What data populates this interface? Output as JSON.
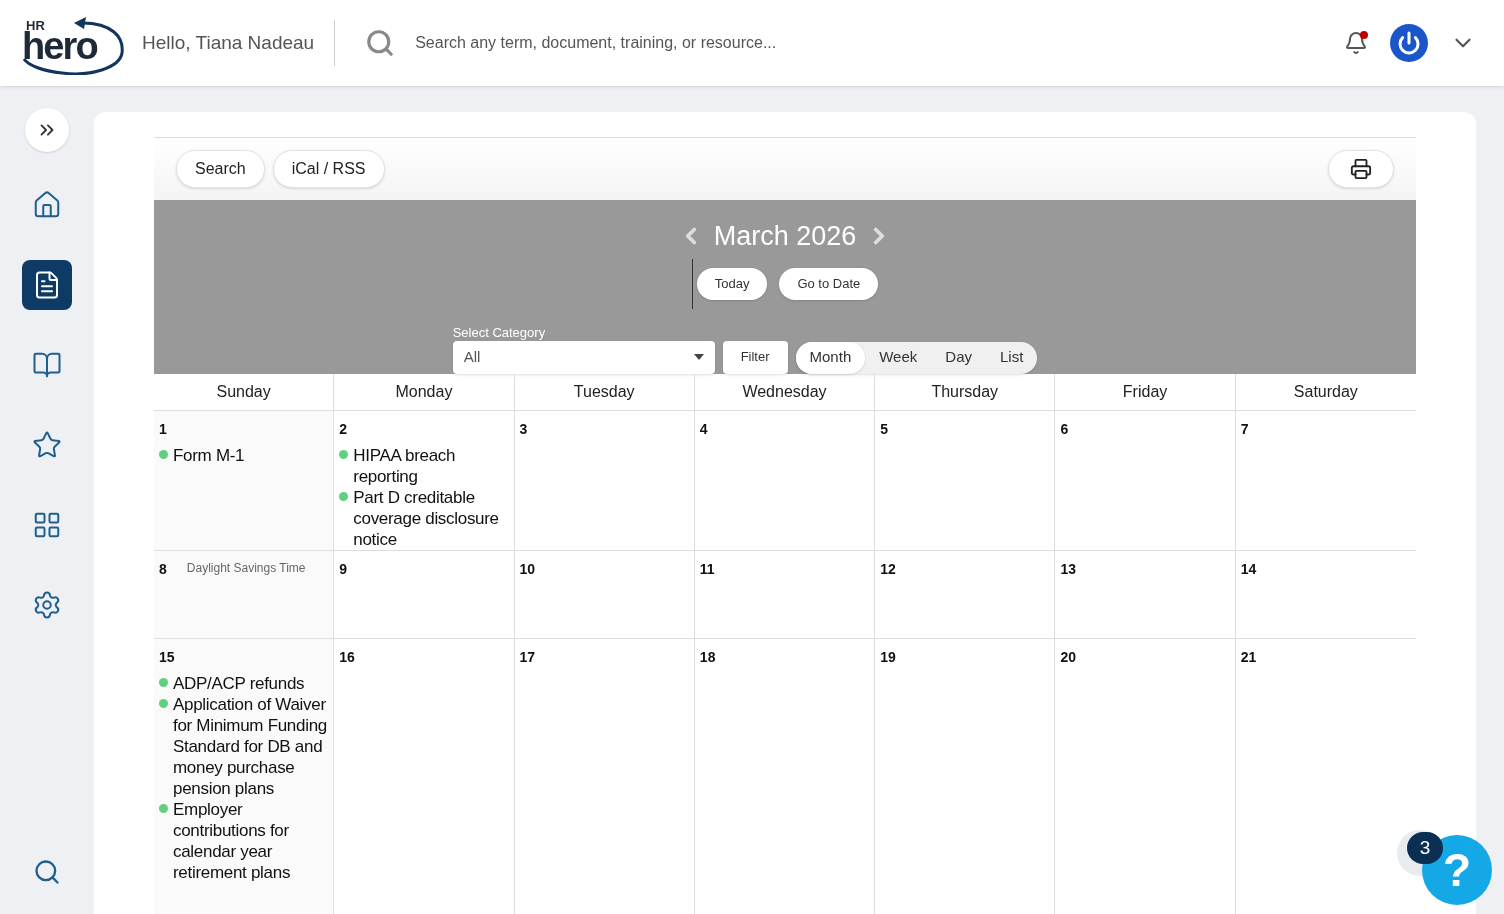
{
  "header": {
    "logo_small": "HR",
    "logo_main": "hero",
    "greeting": "Hello, Tiana Nadeau",
    "search": {
      "placeholder": "Search any term, document, training, or resource..."
    },
    "notification_unread": true
  },
  "sidebar": {
    "items": [
      {
        "kind": "home",
        "selected": false
      },
      {
        "kind": "document",
        "selected": true
      },
      {
        "kind": "book",
        "selected": false
      },
      {
        "kind": "star",
        "selected": false
      },
      {
        "kind": "grid",
        "selected": false
      },
      {
        "kind": "gear",
        "selected": false
      }
    ]
  },
  "toolbar": {
    "buttons": [
      "Search",
      "iCal / RSS"
    ]
  },
  "calendar": {
    "month": "March 2026",
    "nav_buttons": [
      "Today",
      "Go to Date"
    ],
    "category_label": "Select Category",
    "category_value": "All",
    "filter": "Filter",
    "views": [
      {
        "label": "Month",
        "selected": true
      },
      {
        "label": "Week",
        "selected": false
      },
      {
        "label": "Day",
        "selected": false
      },
      {
        "label": "List",
        "selected": false
      }
    ],
    "weekdays": [
      "Sunday",
      "Monday",
      "Tuesday",
      "Wednesday",
      "Thursday",
      "Friday",
      "Saturday"
    ],
    "weeks": [
      [
        {
          "day": "1",
          "events": [
            "Form M-1"
          ]
        },
        {
          "day": "2",
          "events": [
            "HIPAA breach reporting",
            "Part D creditable coverage disclosure notice"
          ]
        },
        {
          "day": "3"
        },
        {
          "day": "4"
        },
        {
          "day": "5"
        },
        {
          "day": "6"
        },
        {
          "day": "7"
        }
      ],
      [
        {
          "day": "8",
          "note": "Daylight Savings Time"
        },
        {
          "day": "9"
        },
        {
          "day": "10"
        },
        {
          "day": "11"
        },
        {
          "day": "12"
        },
        {
          "day": "13"
        },
        {
          "day": "14"
        }
      ],
      [
        {
          "day": "15",
          "events": [
            "ADP/ACP refunds",
            "Application of Waiver for Minimum Funding Standard for DB and money purchase pension plans",
            "Employer contributions for calendar year retirement plans"
          ]
        },
        {
          "day": "16"
        },
        {
          "day": "17"
        },
        {
          "day": "18"
        },
        {
          "day": "19"
        },
        {
          "day": "20"
        },
        {
          "day": "21"
        }
      ]
    ]
  },
  "help": {
    "count": "3",
    "symbol": "?"
  }
}
